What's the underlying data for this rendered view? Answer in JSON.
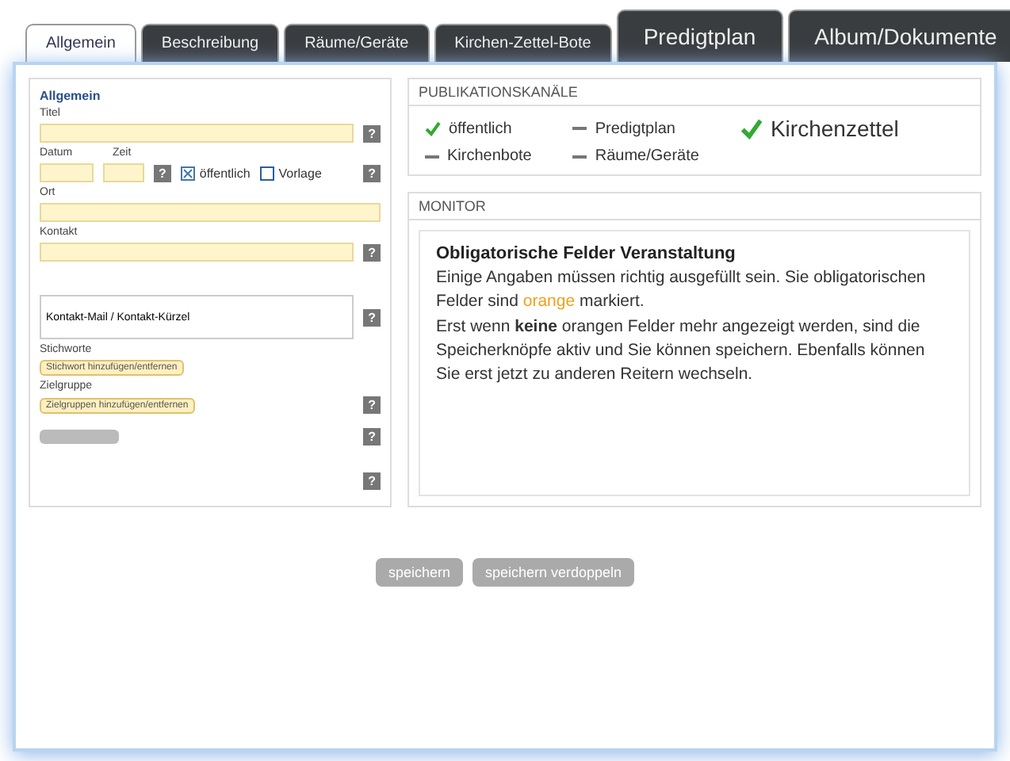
{
  "tabs": [
    {
      "label": "Allgemein",
      "selected": true
    },
    {
      "label": "Beschreibung",
      "selected": false
    },
    {
      "label": "Räume/Geräte",
      "selected": false
    },
    {
      "label": "Kirchen-Zettel-Bote",
      "selected": false
    },
    {
      "label": "Predigtplan",
      "selected": false
    },
    {
      "label": "Album/Dokumente",
      "selected": false
    }
  ],
  "form": {
    "heading": "Allgemein",
    "help": "?",
    "titel": {
      "label": "Titel"
    },
    "datum": {
      "label": "Datum"
    },
    "zeit": {
      "label": "Zeit"
    },
    "options": [
      {
        "label": "öffentlich",
        "checked": true
      },
      {
        "label": "Vorlage",
        "checked": false
      }
    ],
    "ort": {
      "label": "Ort"
    },
    "kontakt": {
      "label": "Kontakt"
    },
    "kontakt_list": {
      "option": "Kontakt-Mail / Kontakt-Kürzel"
    },
    "stichworte": {
      "label": "Stichworte",
      "tag": "Stichwort hinzufügen/entfernen"
    },
    "zielgruppe": {
      "label": "Zielgruppe",
      "tag": "Zielgruppen hinzufügen/entfernen"
    }
  },
  "channels": {
    "title": "PUBLIKATIONSKANÄLE",
    "items": [
      {
        "label": "öffentlich",
        "checked": true
      },
      {
        "label": "Predigtplan",
        "checked": false
      },
      {
        "label": "Kirchenzettel",
        "checked": true
      },
      {
        "label": "Kirchenbote",
        "checked": false
      },
      {
        "label": "Räume/Geräte",
        "checked": false
      }
    ]
  },
  "monitor": {
    "title": "MONITOR",
    "heading": "Obligatorische Felder Veranstaltung",
    "sentence": {
      "before": "Einige Angaben müssen richtig ausgefüllt sein. Sie obligatorischen Felder sind ",
      "highlight": "orange",
      "after": " markiert."
    },
    "paragraph": "Erst wenn **keine** orangen Felder mehr angezeigt werden, sind die Speicherknöpfe aktiv und Sie können speichern. Ebenfalls können Sie erst jetzt zu anderen Reitern wechseln."
  },
  "buttons": [
    "speichern",
    "speichern verdoppeln"
  ]
}
